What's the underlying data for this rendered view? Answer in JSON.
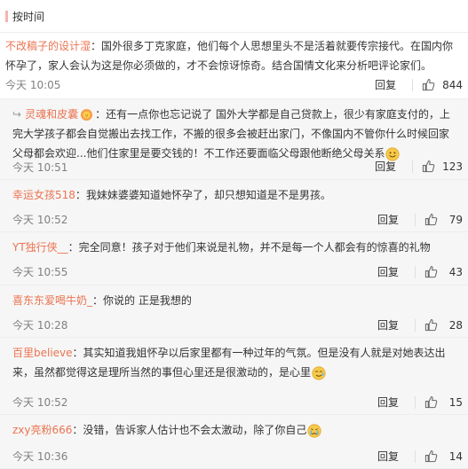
{
  "sort": {
    "label": "按时间"
  },
  "main_comment": {
    "user": "不改稿子的设计湿",
    "text": "：国外很多丁克家庭，他们每个人思想里头不是活着就要传宗接代。在国内你怀孕了，家人会认为这是你必须做的，才不会惊讶惊奇。结合国情文化来分析吧评论家们。",
    "time": "今天 10:05",
    "reply_label": "回复",
    "likes": "844"
  },
  "replies": [
    {
      "prefix": "↪",
      "user": "灵魂和皮囊",
      "text": "：还有一点你也忘记说了 国外大学都是自己贷款上，很少有家庭支付的，上完大学孩子都会自觉搬出去找工作，不搬的很多会被赶出家门，不像国内不管你什么时候回家父母都会欢迎...他们住家里是要交钱的！不工作还要面临父母跟他断绝父母关系",
      "time": "今天 10:51",
      "reply_label": "回复",
      "likes": "123"
    },
    {
      "user": "幸运女孩518",
      "text": "：我妹妹婆婆知道她怀孕了，却只想知道是不是男孩。",
      "time": "今天 10:52",
      "reply_label": "回复",
      "likes": "79"
    },
    {
      "user": "YT独行侠__",
      "text": "：完全同意！孩子对于他们来说是礼物，并不是每一个人都会有的惊喜的礼物",
      "time": "今天 10:55",
      "reply_label": "回复",
      "likes": "43"
    },
    {
      "user": "喜东东爱喝牛奶_",
      "text": "：你说的 正是我想的",
      "time": "今天 10:28",
      "reply_label": "回复",
      "likes": "28"
    },
    {
      "user": "百里believe",
      "text": "：其实知道我姐怀孕以后家里都有一种过年的气氛。但是没有人就是对她表达出来，虽然都觉得这是理所当然的事但心里还是很激动的，是心里",
      "time": "今天 10:52",
      "reply_label": "回复",
      "likes": "15"
    },
    {
      "user": "zxy亮粉666",
      "text": "：没错，告诉家人估计也不会太激动，除了你自己",
      "time": "今天 10:36",
      "reply_label": "回复",
      "likes": "14"
    }
  ],
  "colors": {
    "username": "#eb7350",
    "time": "#808080",
    "reply_bg": "#f6f6f6"
  },
  "icons": {
    "like": "thumbs-up-icon",
    "badge": "member-badge-icon",
    "emoji": "smile-emoji-icon"
  }
}
